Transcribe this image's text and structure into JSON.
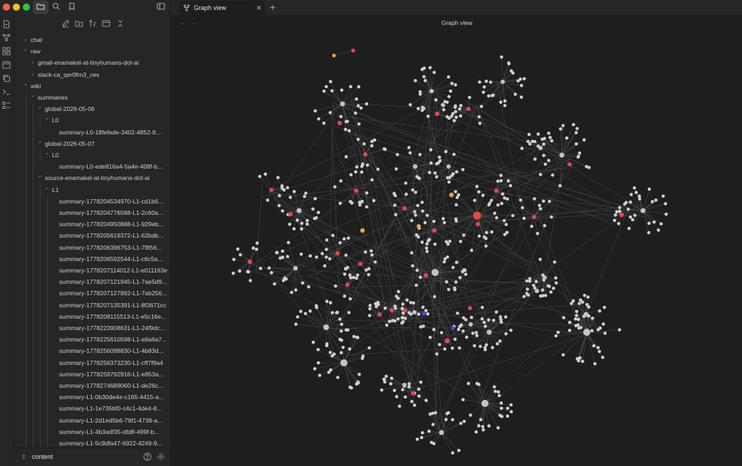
{
  "window": {
    "active_tab": {
      "label": "Graph view",
      "icon": "git-fork-icon"
    },
    "new_tab_symbol": "+",
    "close_symbol": "×"
  },
  "chrome_buttons": [
    "folder-icon",
    "search-icon",
    "bookmark-icon",
    "sidebar-toggle-icon"
  ],
  "ribbon": [
    "new-note-icon",
    "graph-icon",
    "canvas-icon",
    "calendar-icon",
    "copy-icon",
    "terminal-icon",
    "checklist-icon"
  ],
  "file_toolbar": [
    "new-note-icon",
    "new-folder-icon",
    "sort-icon",
    "collapse-all-icon",
    "close-icon"
  ],
  "tree": [
    {
      "label": "chat",
      "depth": 0,
      "chevron": "right"
    },
    {
      "label": "raw",
      "depth": 0,
      "chevron": "down"
    },
    {
      "label": "gmail-enamakel-at-tinyhumans-dot-ai",
      "depth": 1,
      "chevron": "right"
    },
    {
      "label": "slack-ca_qer0frn3_ces",
      "depth": 1,
      "chevron": "right"
    },
    {
      "label": "wiki",
      "depth": 0,
      "chevron": "down"
    },
    {
      "label": "summaries",
      "depth": 1,
      "chevron": "down"
    },
    {
      "label": "global-2026-05-06",
      "depth": 2,
      "chevron": "down"
    },
    {
      "label": "L0",
      "depth": 3,
      "chevron": "down"
    },
    {
      "label": "summary-L0-18fefede-3402-4852-9...",
      "depth": 4,
      "chevron": ""
    },
    {
      "label": "global-2026-05-07",
      "depth": 2,
      "chevron": "down"
    },
    {
      "label": "L0",
      "depth": 3,
      "chevron": "down"
    },
    {
      "label": "summary-L0-ede816a4-5a4e-408f-b...",
      "depth": 4,
      "chevron": ""
    },
    {
      "label": "source-enamakel-at-tinyhumans-dot-ai",
      "depth": 2,
      "chevron": "down"
    },
    {
      "label": "L1",
      "depth": 3,
      "chevron": "down"
    },
    {
      "label": "summary-1778204534970-L1-cd1b6...",
      "depth": 4,
      "chevron": ""
    },
    {
      "label": "summary-1778204776588-L1-2c60a...",
      "depth": 4,
      "chevron": ""
    },
    {
      "label": "summary-1778204950888-L1-929eb...",
      "depth": 4,
      "chevron": ""
    },
    {
      "label": "summary-1778205619372-L1-62bdb...",
      "depth": 4,
      "chevron": ""
    },
    {
      "label": "summary-1778206396753-L1-7f856...",
      "depth": 4,
      "chevron": ""
    },
    {
      "label": "summary-1778206592544-L1-c6c5a...",
      "depth": 4,
      "chevron": ""
    },
    {
      "label": "summary-1778207114012-L1-e011163e",
      "depth": 4,
      "chevron": ""
    },
    {
      "label": "summary-1778207121945-L1-7ae5d9...",
      "depth": 4,
      "chevron": ""
    },
    {
      "label": "summary-1778207127992-L1-7ab256...",
      "depth": 4,
      "chevron": ""
    },
    {
      "label": "summary-1778207135391-L1-8f3671cc",
      "depth": 4,
      "chevron": ""
    },
    {
      "label": "summary-1778208115513-L1-e5c16e...",
      "depth": 4,
      "chevron": ""
    },
    {
      "label": "summary-1778223908631-L1-24f9dc...",
      "depth": 4,
      "chevron": ""
    },
    {
      "label": "summary-1778225610598-L1-a9a6a7...",
      "depth": 4,
      "chevron": ""
    },
    {
      "label": "summary-1778256098830-L1-4b83d...",
      "depth": 4,
      "chevron": ""
    },
    {
      "label": "summary-1778256373230-L1-cff7f9a4",
      "depth": 4,
      "chevron": ""
    },
    {
      "label": "summary-1778259792916-L1-e853a...",
      "depth": 4,
      "chevron": ""
    },
    {
      "label": "summary-1778274689060-L1-de26c...",
      "depth": 4,
      "chevron": ""
    },
    {
      "label": "summary-L1-0b30de4e-c165-4415-a...",
      "depth": 4,
      "chevron": ""
    },
    {
      "label": "summary-L1-1e735bf0-c4c1-4de4-8...",
      "depth": 4,
      "chevron": ""
    },
    {
      "label": "summary-L1-2d1ed5b6-79f1-4738-a...",
      "depth": 4,
      "chevron": ""
    },
    {
      "label": "summary-L1-4b3adf35-dfd8-499f-b...",
      "depth": 4,
      "chevron": ""
    },
    {
      "label": "summary-L1-5c9dfa47-6922-4249-9...",
      "depth": 4,
      "chevron": ""
    }
  ],
  "vault": {
    "name": "content",
    "switch_icon": "chevron-up-down-icon",
    "help_icon": "help-icon",
    "settings_icon": "gear-icon"
  },
  "view": {
    "title": "Graph view",
    "back_symbol": "←",
    "forward_symbol": "→"
  },
  "graph": {
    "colors": {
      "node": "#cfcfcf",
      "hub": "#c4c4c4",
      "red": "#e5484d",
      "orange": "#e5a841",
      "blue": "#3b4fe0",
      "edge": "#4a4a4a",
      "background": "#1e1e1e"
    }
  }
}
